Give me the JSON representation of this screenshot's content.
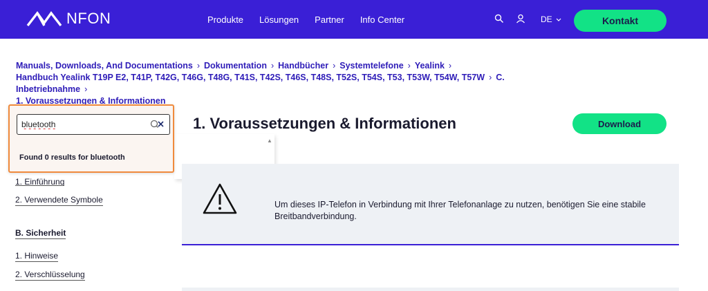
{
  "nav": {
    "logo_text": "NFON",
    "links": [
      "Produkte",
      "Lösungen",
      "Partner",
      "Info Center"
    ],
    "lang": "DE",
    "contact": "Kontakt"
  },
  "breadcrumb": [
    "Manuals, Downloads, And Documentations",
    "Dokumentation",
    "Handbücher",
    "Systemtelefone",
    "Yealink",
    "Handbuch Yealink T19P E2, T41P, T42G, T46G, T48G, T41S, T42S, T46S, T48S, T52S, T54S, T53, T53W, T54W, T57W",
    "C. Inbetriebnahme",
    "1. Voraussetzungen & Informationen"
  ],
  "search": {
    "value": "bluetooth",
    "results_text": "Found 0 results for bluetooth"
  },
  "sidebar": {
    "item_einfuehrung": "1. Einführung",
    "item_symbole": "2. Verwendete Symbole",
    "section_sicherheit": "B. Sicherheit",
    "item_hinweise": "1. Hinweise",
    "item_verschluesselung": "2. Verschlüsselung"
  },
  "main": {
    "title": "1. Voraussetzungen & Informationen",
    "download": "Download",
    "notice": "Um dieses IP-Telefon in Verbindung mit Ihrer Telefonanlage zu nutzen, benötigen Sie eine stabile Breitbandverbindung."
  },
  "colors": {
    "brand": "#3a1fd6",
    "accent": "#12e286",
    "highlight": "#f08a3c"
  },
  "icons": {
    "search": "search-icon",
    "user": "user-icon",
    "warning": "warning-icon",
    "clear": "clear-search-icon"
  }
}
